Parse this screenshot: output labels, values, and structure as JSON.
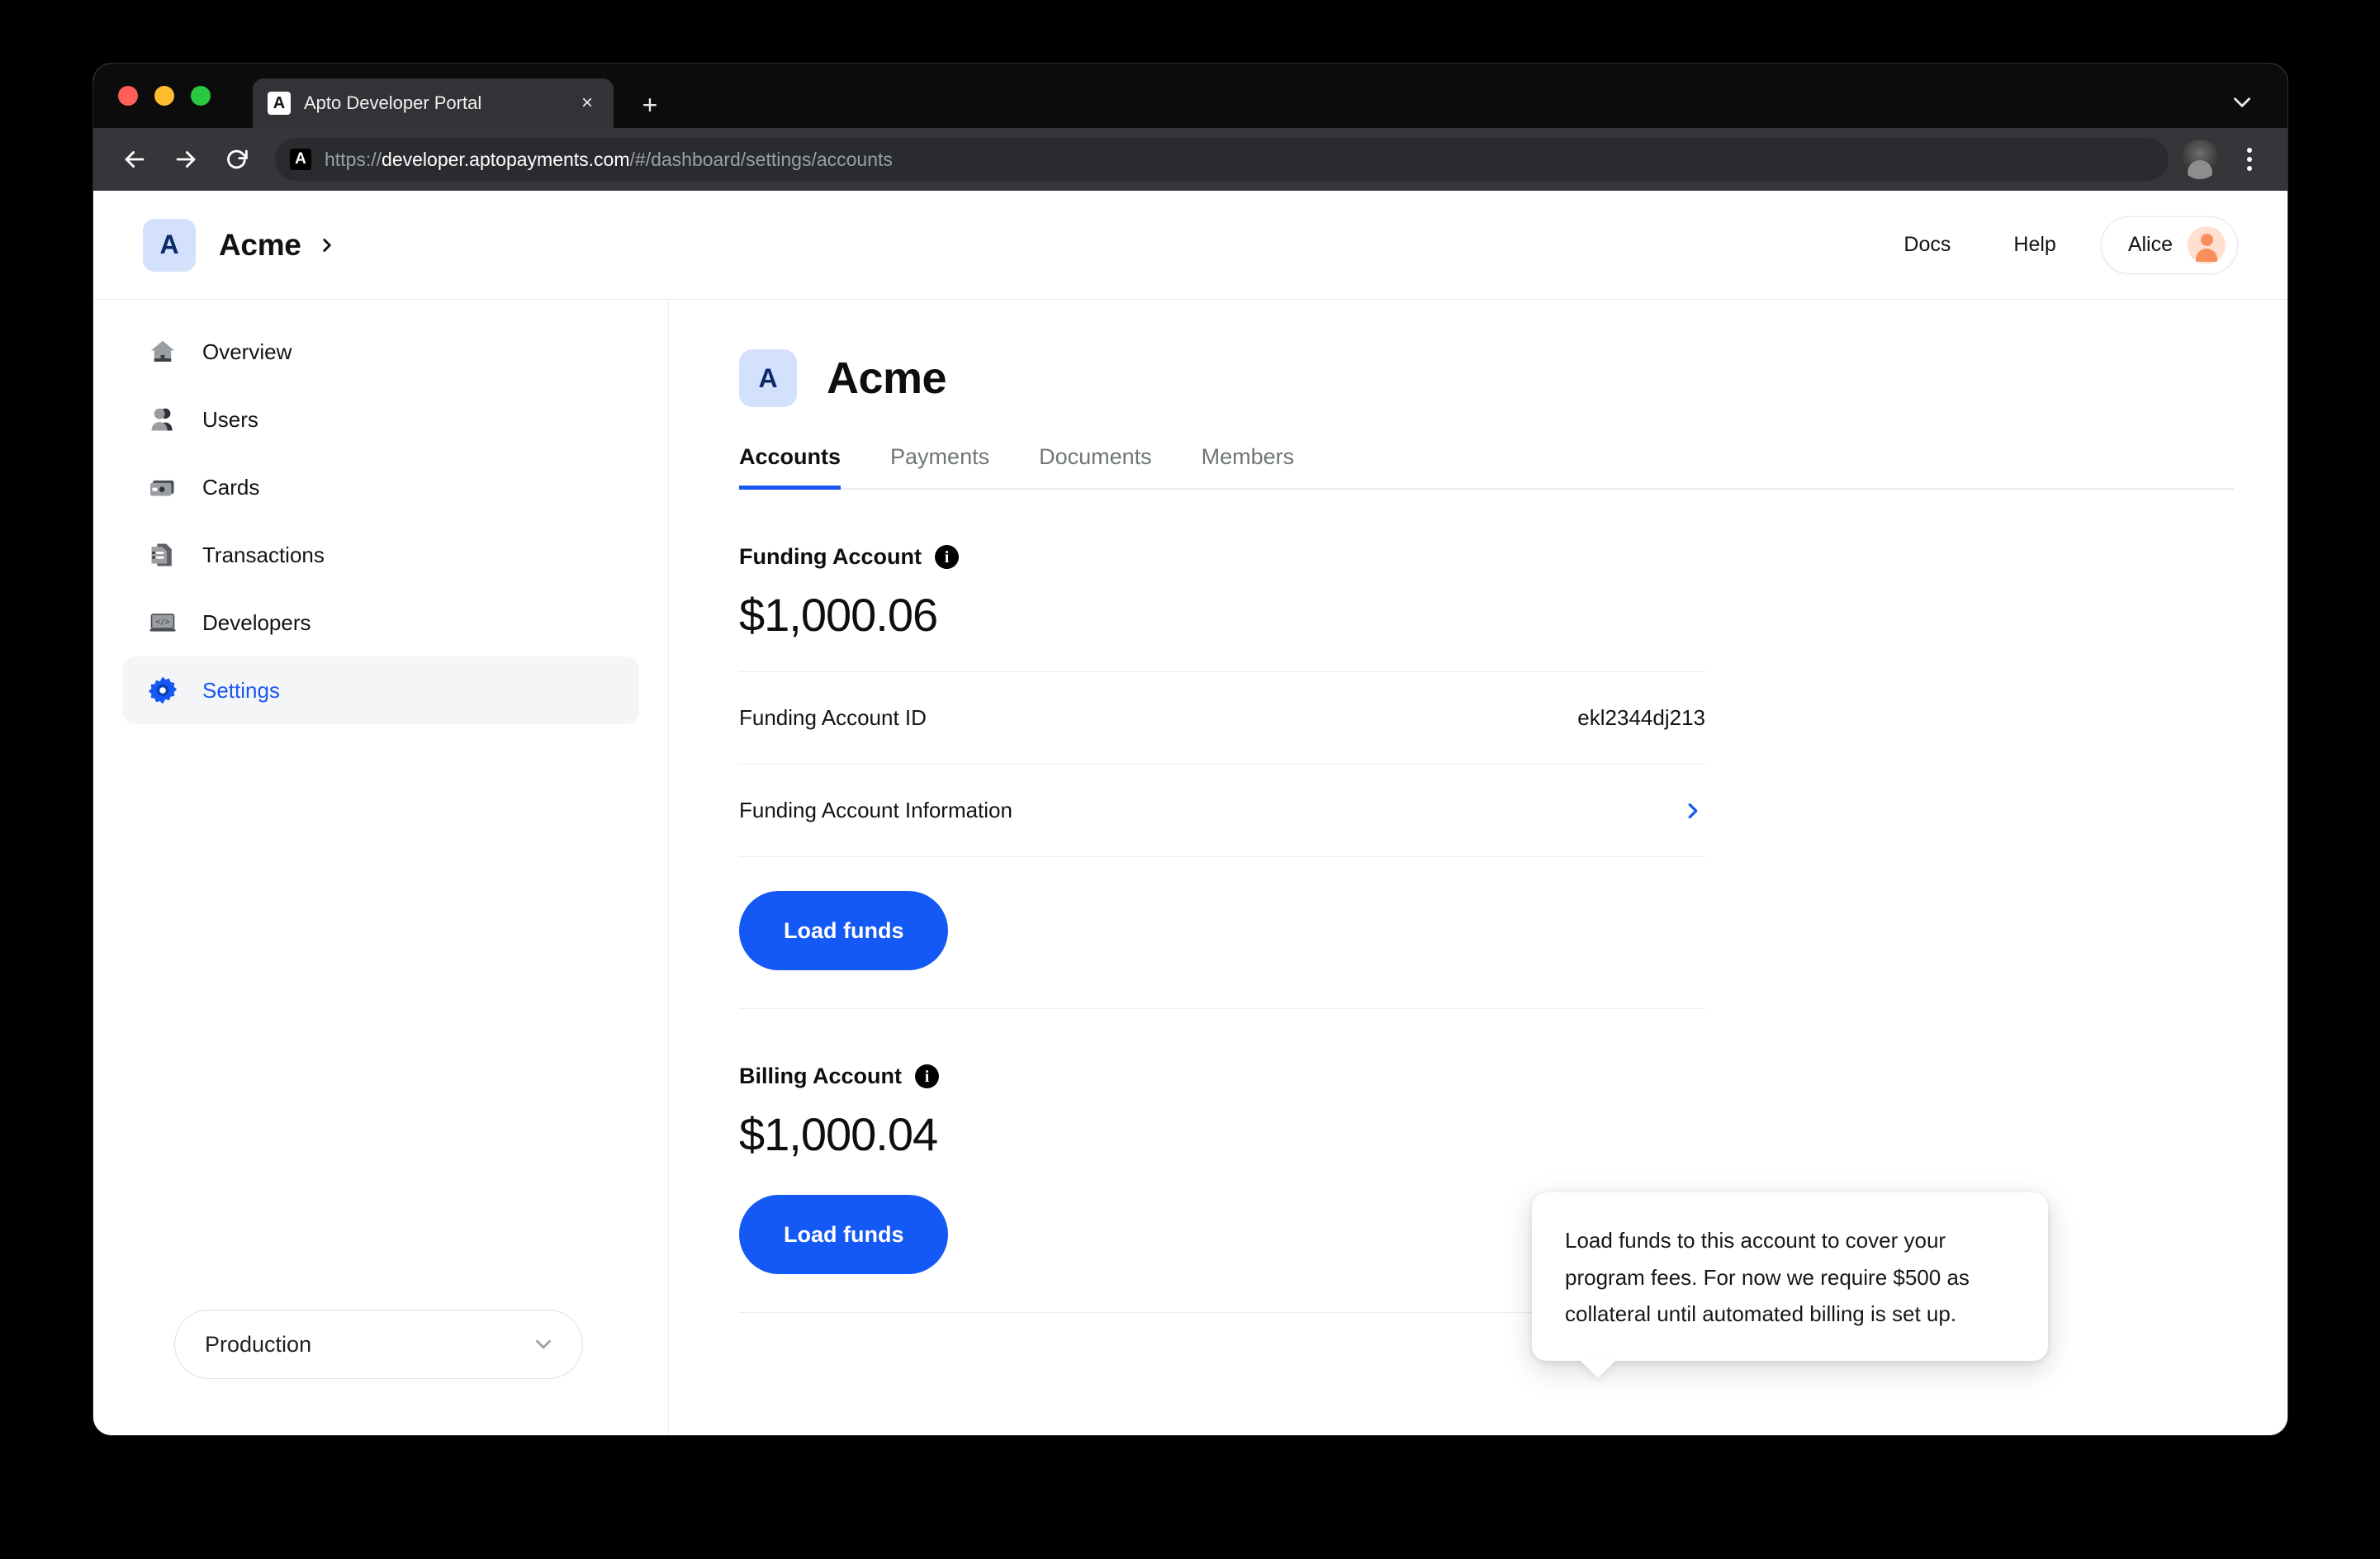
{
  "browser": {
    "tab": {
      "favicon_letter": "A",
      "title": "Apto Developer Portal",
      "close_label": "×"
    },
    "new_tab_label": "+",
    "omnibox": {
      "favicon_letter": "A",
      "url_prefix": "https://",
      "url_host": "developer.aptopayments.com",
      "url_path": "/#/dashboard/settings/accounts"
    }
  },
  "header": {
    "org_logo_letter": "A",
    "org_name": "Acme",
    "links": [
      {
        "label": "Docs"
      },
      {
        "label": "Help"
      }
    ],
    "user": {
      "name": "Alice"
    }
  },
  "sidebar": {
    "items": [
      {
        "label": "Overview",
        "icon": "home-icon",
        "active": false
      },
      {
        "label": "Users",
        "icon": "users-icon",
        "active": false
      },
      {
        "label": "Cards",
        "icon": "card-icon",
        "active": false
      },
      {
        "label": "Transactions",
        "icon": "transactions-icon",
        "active": false
      },
      {
        "label": "Developers",
        "icon": "developers-icon",
        "active": false
      },
      {
        "label": "Settings",
        "icon": "gear-icon",
        "active": true
      }
    ],
    "environment": {
      "value": "Production"
    }
  },
  "main": {
    "page_logo_letter": "A",
    "page_title": "Acme",
    "tabs": [
      {
        "label": "Accounts",
        "active": true
      },
      {
        "label": "Payments",
        "active": false
      },
      {
        "label": "Documents",
        "active": false
      },
      {
        "label": "Members",
        "active": false
      }
    ],
    "funding_account": {
      "label": "Funding Account",
      "info_glyph": "i",
      "balance": "$1,000.06",
      "rows": [
        {
          "label": "Funding Account ID",
          "value": "ekl2344dj213"
        },
        {
          "label": "Funding Account Information",
          "value": "",
          "chevron": true
        }
      ],
      "load_funds_label": "Load funds"
    },
    "billing_account": {
      "label": "Billing Account",
      "info_glyph": "i",
      "balance": "$1,000.04",
      "load_funds_label": "Load funds"
    },
    "tooltip": {
      "text": "Load funds to this account to cover your program fees. For now we require $500 as collateral until automated billing is set up."
    }
  },
  "colors": {
    "accent_blue": "#1458f5",
    "tab_underline": "#1a56f0",
    "logo_bg": "#d3e1fc",
    "avatar_bg": "#ffe0d0"
  }
}
